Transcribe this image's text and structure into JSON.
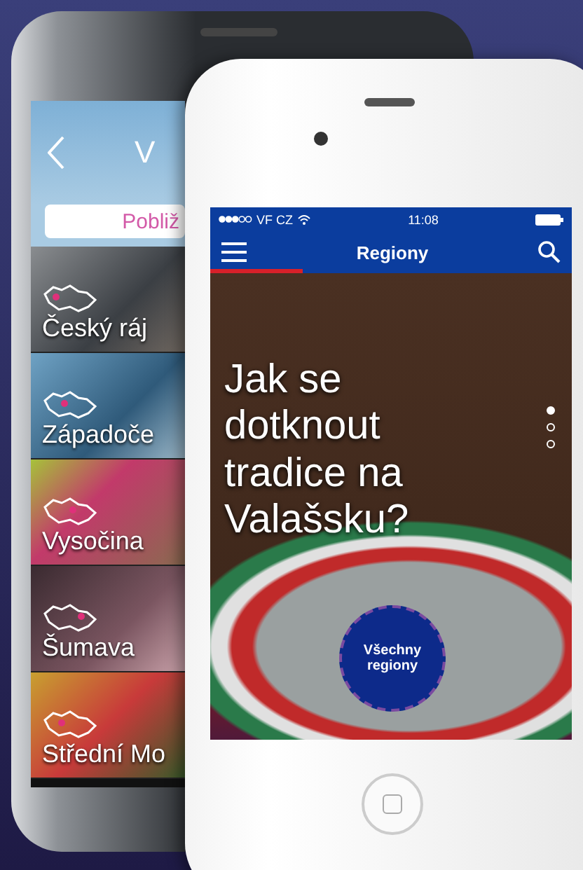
{
  "back_phone": {
    "title": "V",
    "search": {
      "placeholder": "Pobliž"
    },
    "regions": [
      {
        "name": "Český ráj"
      },
      {
        "name": "Západoče"
      },
      {
        "name": "Vysočina"
      },
      {
        "name": "Šumava"
      },
      {
        "name": "Střední Mo"
      }
    ]
  },
  "front_phone": {
    "status_bar": {
      "carrier": "VF CZ",
      "time": "11:08"
    },
    "nav_bar": {
      "title": "Regiony"
    },
    "hero": {
      "headline": "Jak se dotknout tradice na Valašsku?"
    },
    "pager": [
      {
        "selected": true
      },
      {
        "selected": false
      },
      {
        "selected": false
      }
    ],
    "cta_button": "Všechny regiony"
  }
}
